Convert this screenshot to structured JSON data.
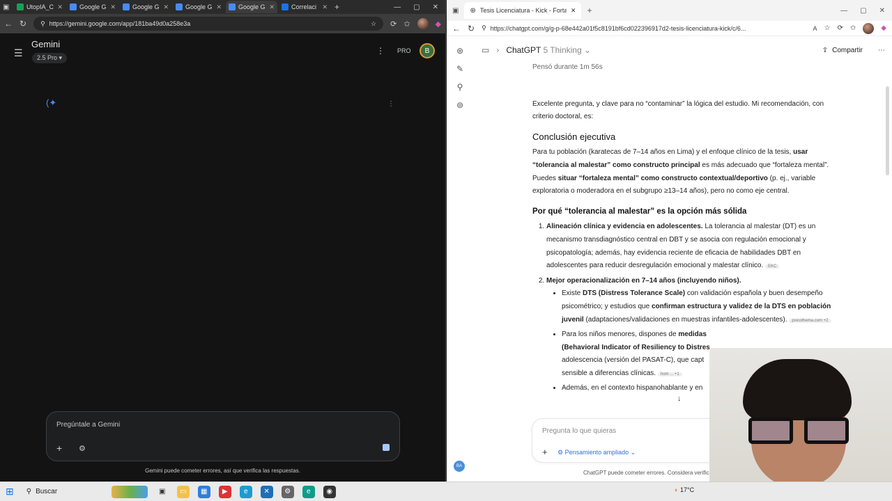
{
  "left": {
    "tabs": [
      {
        "label": "UtopIA_C",
        "color": "#18a058"
      },
      {
        "label": "Google G",
        "color": "#4a8af4"
      },
      {
        "label": "Google G",
        "color": "#4a8af4"
      },
      {
        "label": "Google G",
        "color": "#4a8af4"
      },
      {
        "label": "Google G",
        "color": "#4a8af4"
      },
      {
        "label": "Correlaci",
        "color": "#1a73e8"
      }
    ],
    "url": "https://gemini.google.com/app/181ba49d0a258e3a",
    "app_title": "Gemini",
    "model": "2.5 Pro",
    "pro_label": "PRO",
    "avatar_letter": "B",
    "prompt_placeholder": "Pregúntale a Gemini",
    "disclaimer": "Gemini puede cometer errores, así que verifica las respuestas."
  },
  "right": {
    "tab_label": "Tesis Licenciatura - Kick - Fortalez",
    "url": "https://chatgpt.com/g/g-p-68e442a01f5c8191bf6cd022396917d2-tesis-licenciatura-kick/c/6...",
    "header_title": "ChatGPT",
    "header_model": "5 Thinking",
    "share_label": "Compartir",
    "thought": "Pensó durante 1m 56s",
    "intro": "Excelente pregunta, y clave para no “contaminar” la lógica del estudio. Mi recomendación, con criterio doctoral, es:",
    "h_conclusion": "Conclusión ejecutiva",
    "conclusion_a": "Para tu población (karatecas de 7–14 años en Lima) y el enfoque clínico de la tesis, ",
    "conclusion_b": "usar “tolerancia al malestar” como constructo principal",
    "conclusion_c": " es más adecuado que “fortaleza mental”. Puedes ",
    "conclusion_d": "situar “fortaleza mental” como constructo contextual/deportivo",
    "conclusion_e": " (p. ej., variable exploratoria o moderadora en el subgrupo ≥13–14 años), pero no como eje central.",
    "h_why": "Por qué “tolerancia al malestar” es la opción más sólida",
    "item1_bold": "Alineación clínica y evidencia en adolescentes.",
    "item1_text": " La tolerancia al malestar (DT) es un mecanismo transdiagnóstico central en DBT y se asocia con regulación emocional y psicopatología; además, hay evidencia reciente de eficacia de habilidades DBT en adolescentes para reducir desregulación emocional y malestar clínico.",
    "item1_src": "EKC",
    "item2_bold": "Mejor operacionalización en 7–14 años (incluyendo niños).",
    "bullet1_a": "Existe ",
    "bullet1_b": "DTS (Distress Tolerance Scale)",
    "bullet1_c": " con validación española y buen desempeño psicométrico; y estudios que ",
    "bullet1_d": "confirman estructura y validez de la DTS en población juvenil",
    "bullet1_e": " (adaptaciones/validaciones en muestras infantiles-adolescentes).",
    "bullet1_src": "psicothema.com +2",
    "bullet2_a": "Para los niños menores, dispones de ",
    "bullet2_b": "medidas",
    "bullet2_c": " (Behavioral Indicator of Resiliency to Distres",
    "bullet2_d": "adolescencia (versión del PASAT-C), que capt",
    "bullet2_e": "sensible a diferencias clínicas.",
    "bullet2_src": "hom  ... +1",
    "bullet3": "Además, en el contexto hispanohablante y en",
    "prompt_placeholder": "Pregunta lo que quieras",
    "mode_label": "Pensamiento ampliado",
    "disclaimer": "ChatGPT puede cometer errores. Considera verifica",
    "user_initials": "BA"
  },
  "taskbar": {
    "search_label": "Buscar",
    "weather": "17°C"
  }
}
